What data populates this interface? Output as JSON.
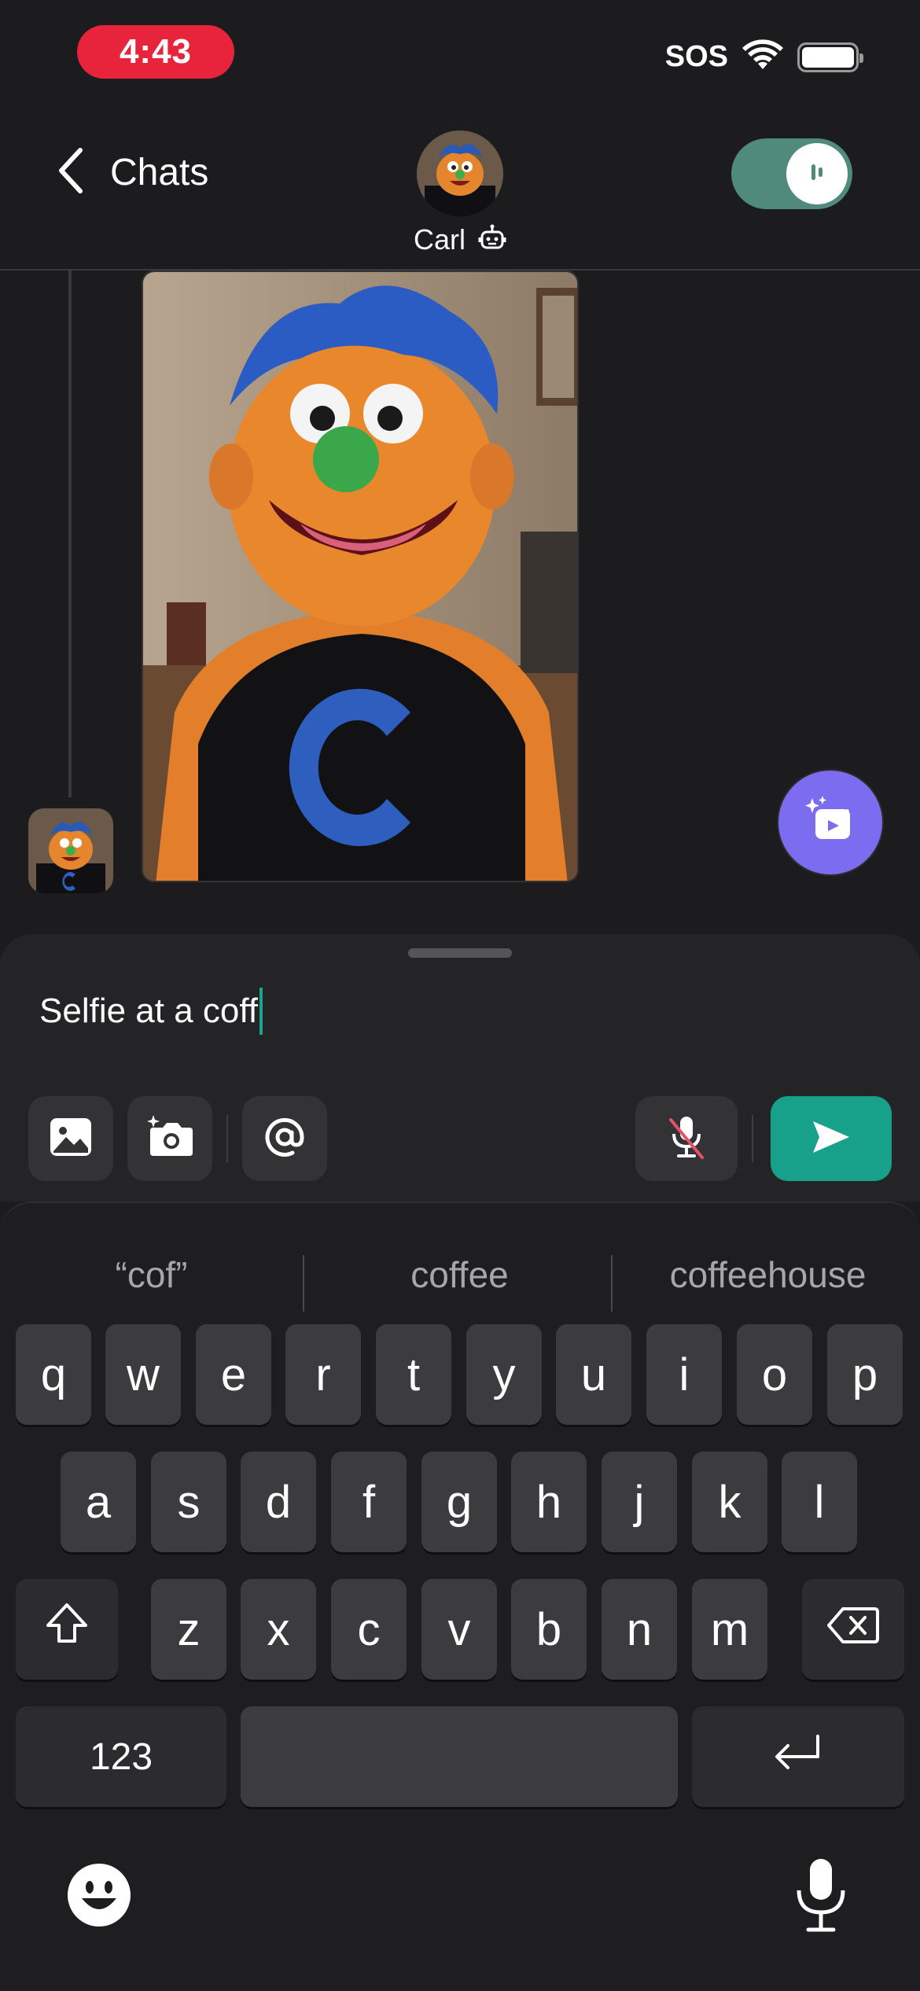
{
  "status_bar": {
    "time": "4:43",
    "sos": "SOS"
  },
  "header": {
    "back_label": "Chats",
    "contact_name": "Carl"
  },
  "composer": {
    "input_value": "Selfie at a coff"
  },
  "keyboard": {
    "suggestions": [
      "“cof”",
      "coffee",
      "coffeehouse"
    ],
    "row1": [
      "q",
      "w",
      "e",
      "r",
      "t",
      "y",
      "u",
      "i",
      "o",
      "p"
    ],
    "row2": [
      "a",
      "s",
      "d",
      "f",
      "g",
      "h",
      "j",
      "k",
      "l"
    ],
    "row3": [
      "z",
      "x",
      "c",
      "v",
      "b",
      "n",
      "m"
    ],
    "numbers_label": "123"
  },
  "colors": {
    "accent": "#17a08a",
    "toggle": "#4f8a7d",
    "magic": "#7c6cf0",
    "time_pill": "#e8243c"
  }
}
